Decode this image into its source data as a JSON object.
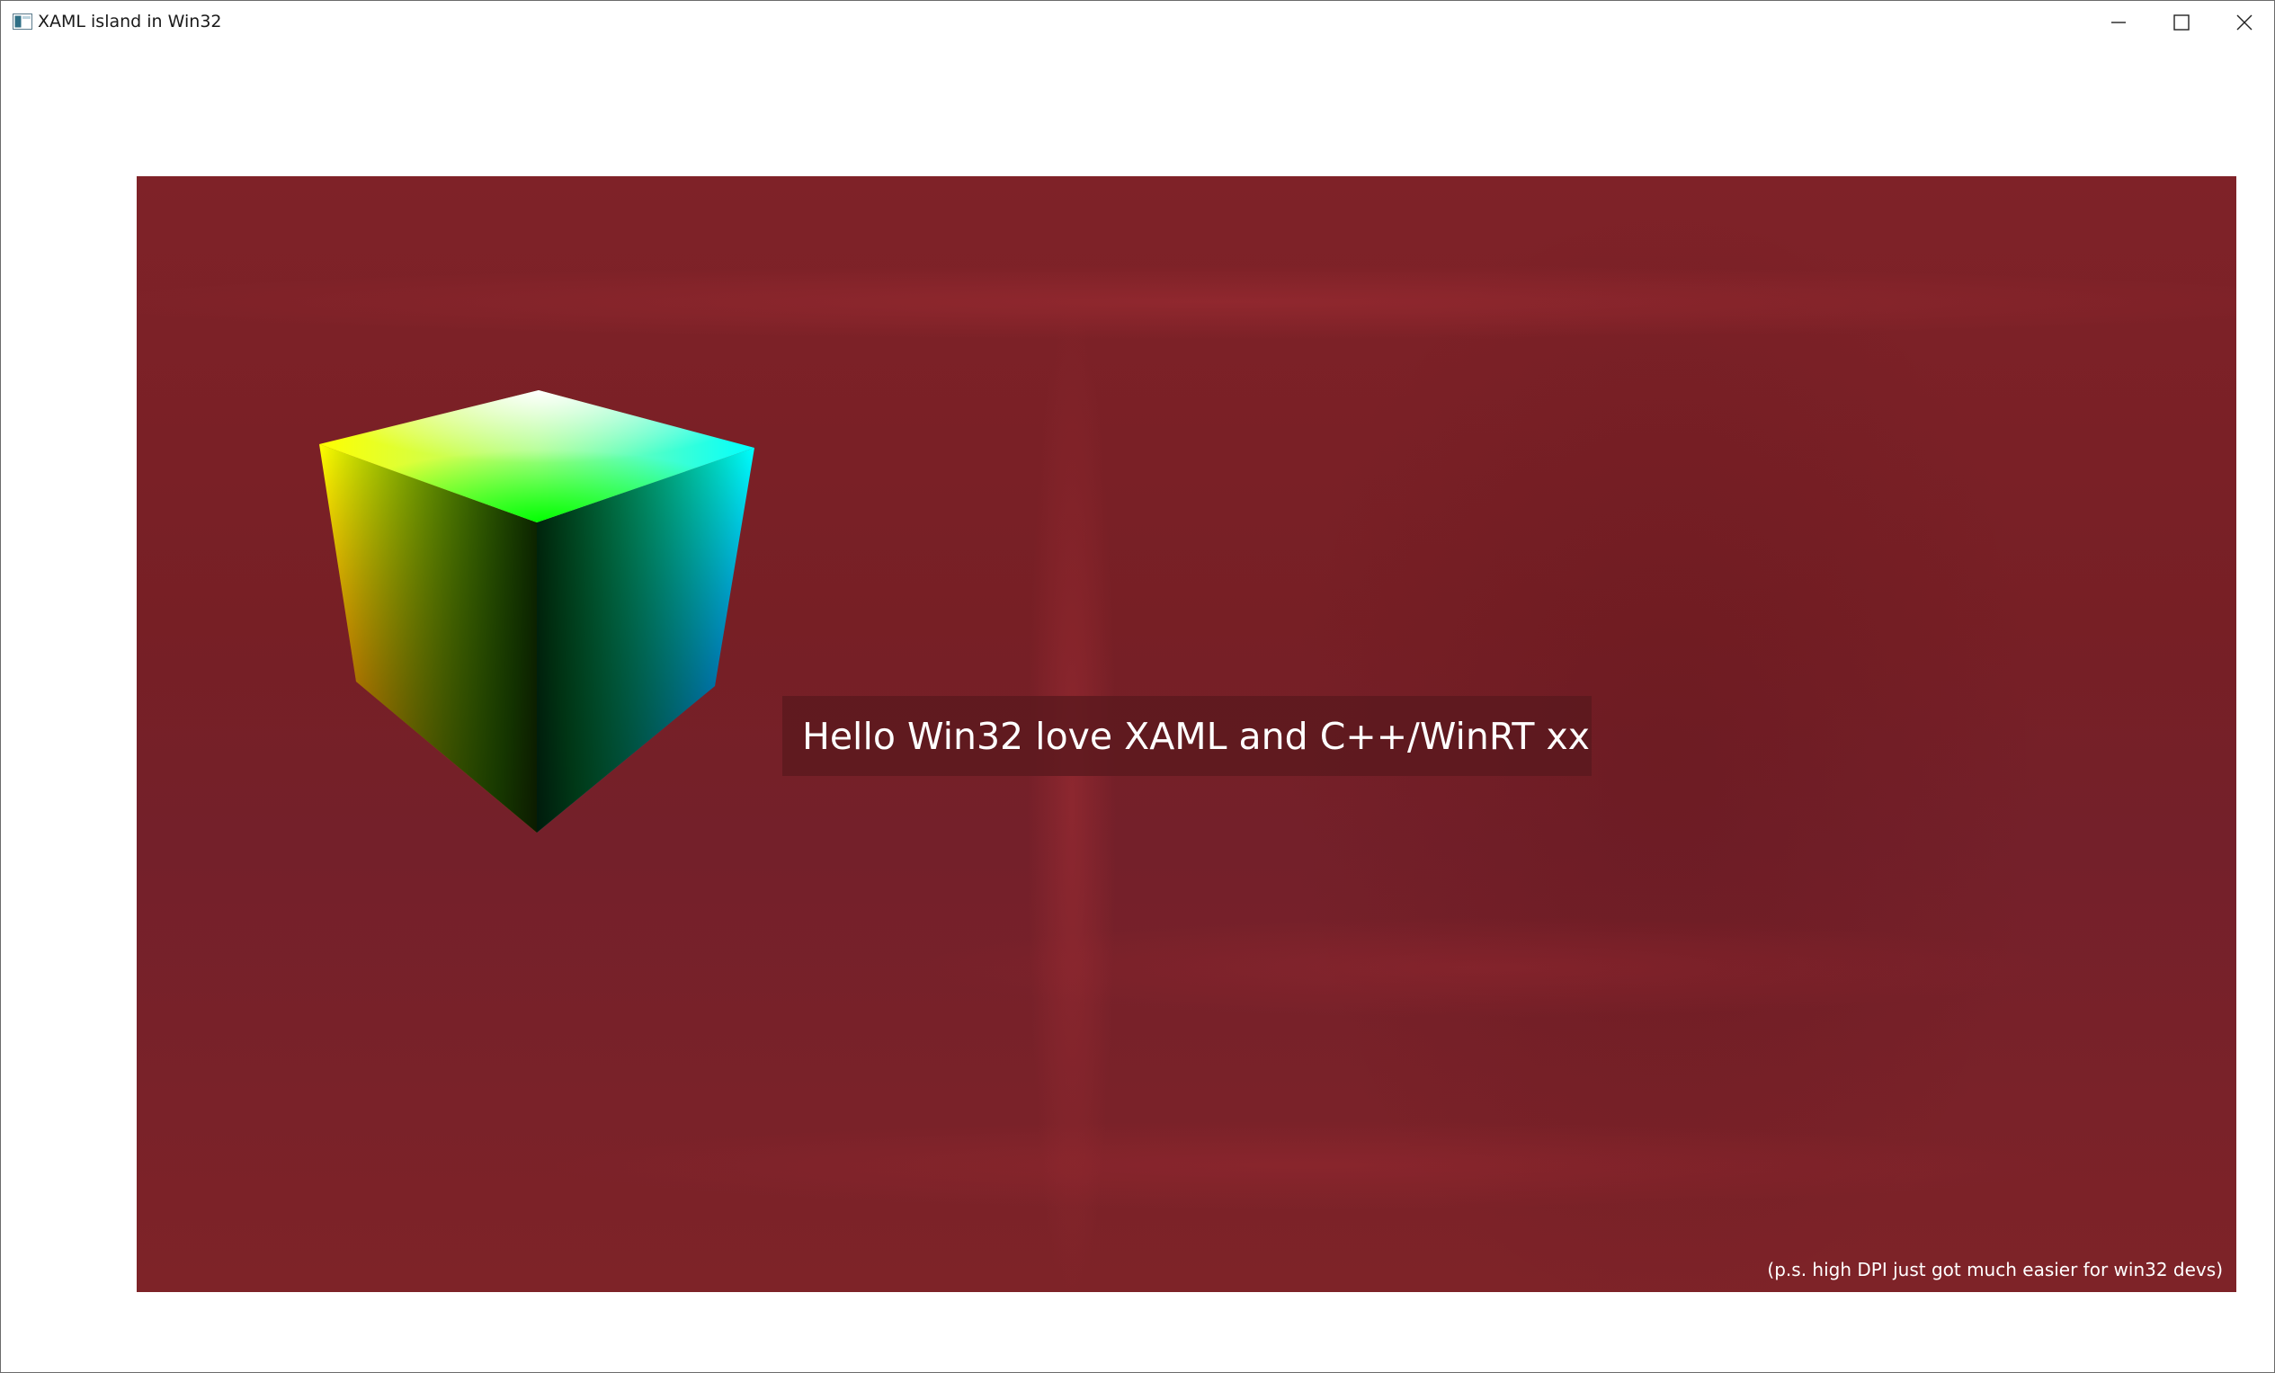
{
  "window": {
    "title": "XAML island in Win32",
    "app_icon": "window-app-icon",
    "controls": {
      "minimize": "minimize-icon",
      "maximize": "maximize-icon",
      "close": "close-icon"
    }
  },
  "island": {
    "background_color": "#7a2026",
    "message": "Hello Win32 love XAML and C++/WinRT xx",
    "footnote": "(p.s. high DPI just got much easier for win32 devs)",
    "cube_graphic": "rgb-color-cube"
  }
}
